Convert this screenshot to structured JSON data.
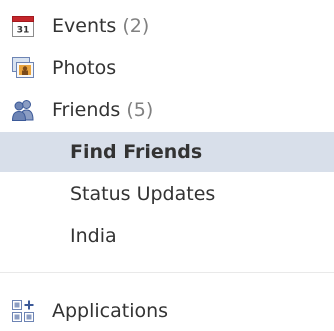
{
  "nav": {
    "events": {
      "label": "Events",
      "count": "(2)",
      "icon": "calendar-icon",
      "calendar_day": "31"
    },
    "photos": {
      "label": "Photos",
      "icon": "photos-icon"
    },
    "friends": {
      "label": "Friends",
      "count": "(5)",
      "icon": "friends-icon"
    },
    "friend_subitems": [
      {
        "label": "Find Friends",
        "selected": true
      },
      {
        "label": "Status Updates",
        "selected": false
      },
      {
        "label": "India",
        "selected": false
      }
    ],
    "applications": {
      "label": "Applications",
      "icon": "applications-icon"
    }
  },
  "colors": {
    "selected_bg": "#d8dfea",
    "text": "#333333",
    "count_text": "#808080",
    "calendar_red": "#c4262b",
    "facebook_blue": "#3b5998"
  }
}
